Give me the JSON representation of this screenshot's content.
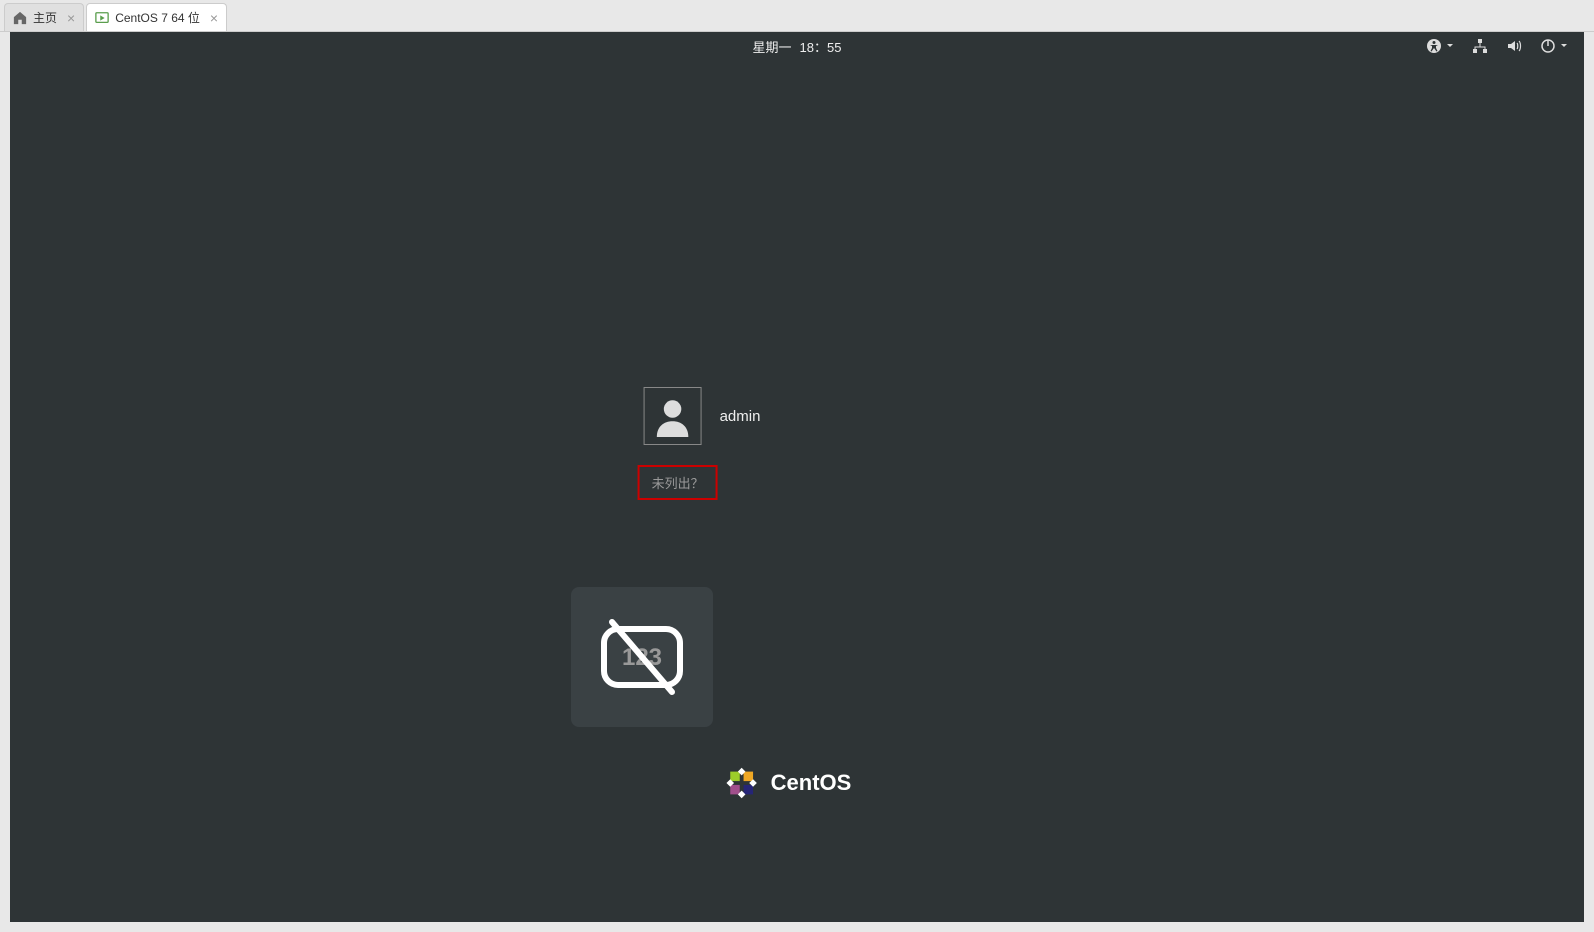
{
  "tabs": [
    {
      "label": "主页",
      "icon": "home-icon"
    },
    {
      "label": "CentOS 7 64 位",
      "icon": "vm-icon",
      "active": true
    }
  ],
  "top_panel": {
    "day": "星期一",
    "time": "18：55"
  },
  "login": {
    "username": "admin",
    "not_listed": "未列出？"
  },
  "branding": {
    "name": "CentOS"
  }
}
